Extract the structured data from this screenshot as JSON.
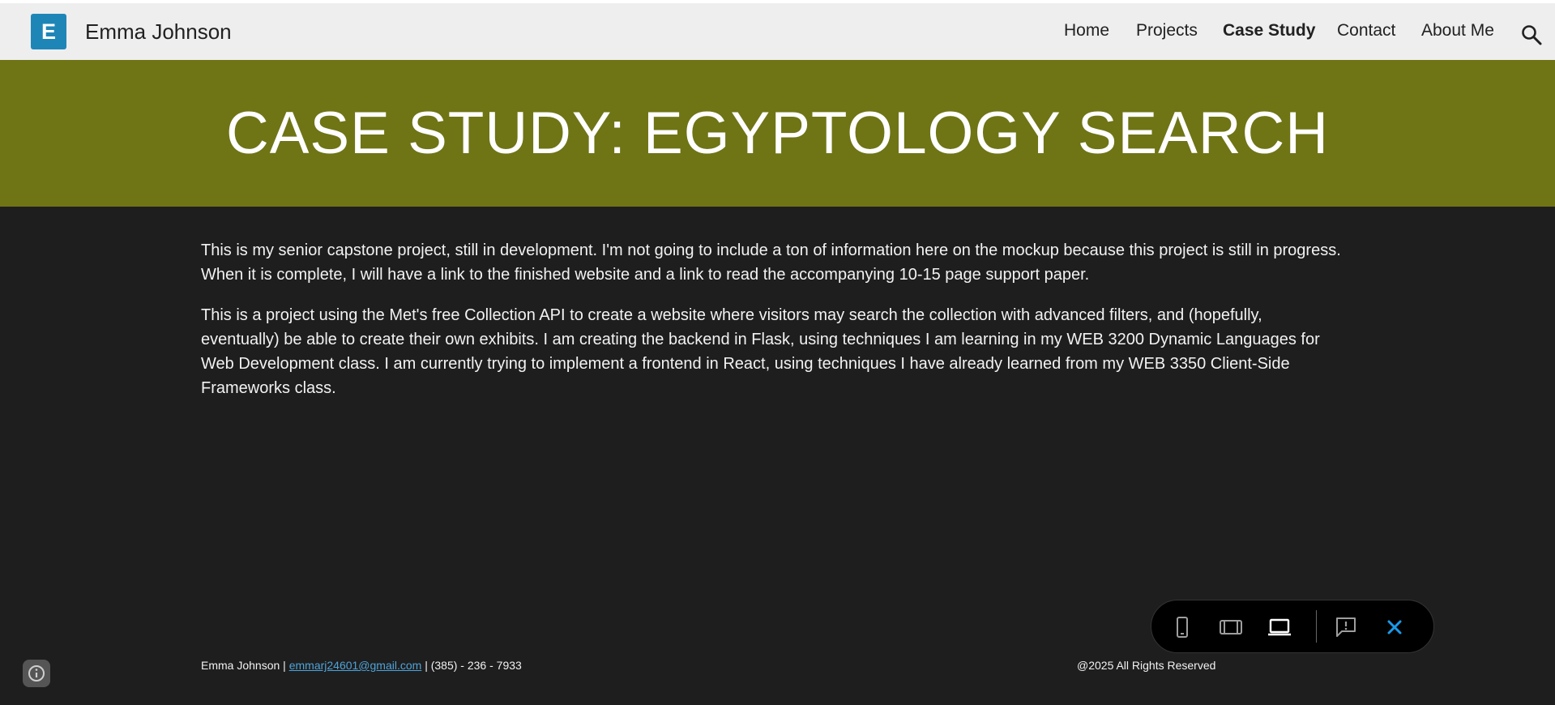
{
  "header": {
    "logo_letter": "E",
    "site_title": "Emma Johnson",
    "nav": [
      {
        "label": "Home",
        "active": false
      },
      {
        "label": "Projects",
        "active": false
      },
      {
        "label": "Case Study",
        "active": true
      },
      {
        "label": "Contact",
        "active": false
      },
      {
        "label": "About Me",
        "active": false
      }
    ],
    "search_icon": "search-icon"
  },
  "hero": {
    "title": "CASE STUDY: EGYPTOLOGY SEARCH",
    "background": "#6f7415"
  },
  "content": {
    "paragraphs": [
      "This is my senior capstone project, still in development. I'm not going to include a ton of information here on the mockup because this project is still in progress. When it is complete, I will have a link to the finished website and a link to read the accompanying 10-15 page support paper.",
      "This is a project using the Met's free Collection API to create a website where visitors may search the collection with advanced filters, and (hopefully, eventually) be able to create their own exhibits. I am creating the backend in Flask, using techniques I am learning in my WEB 3200 Dynamic Languages for Web Development class. I am currently trying to implement a frontend in React, using techniques I have already learned from my WEB 3350 Client-Side Frameworks class."
    ]
  },
  "footer": {
    "name": "Emma Johnson",
    "separator": " | ",
    "email": "emmarj24601@gmail.com",
    "phone": "(385) - 236 - 7933",
    "copyright": "@2025 All Rights Reserved"
  },
  "preview_bar": {
    "icons": [
      "phone-preview-icon",
      "tablet-preview-icon",
      "laptop-preview-icon",
      "report-icon",
      "close-icon"
    ],
    "accent": "#1a9be8"
  },
  "colors": {
    "topbar": "#eeeeee",
    "logo": "#1e86b7",
    "page_background": "#1e1e1e",
    "link": "#4ea3d9"
  }
}
